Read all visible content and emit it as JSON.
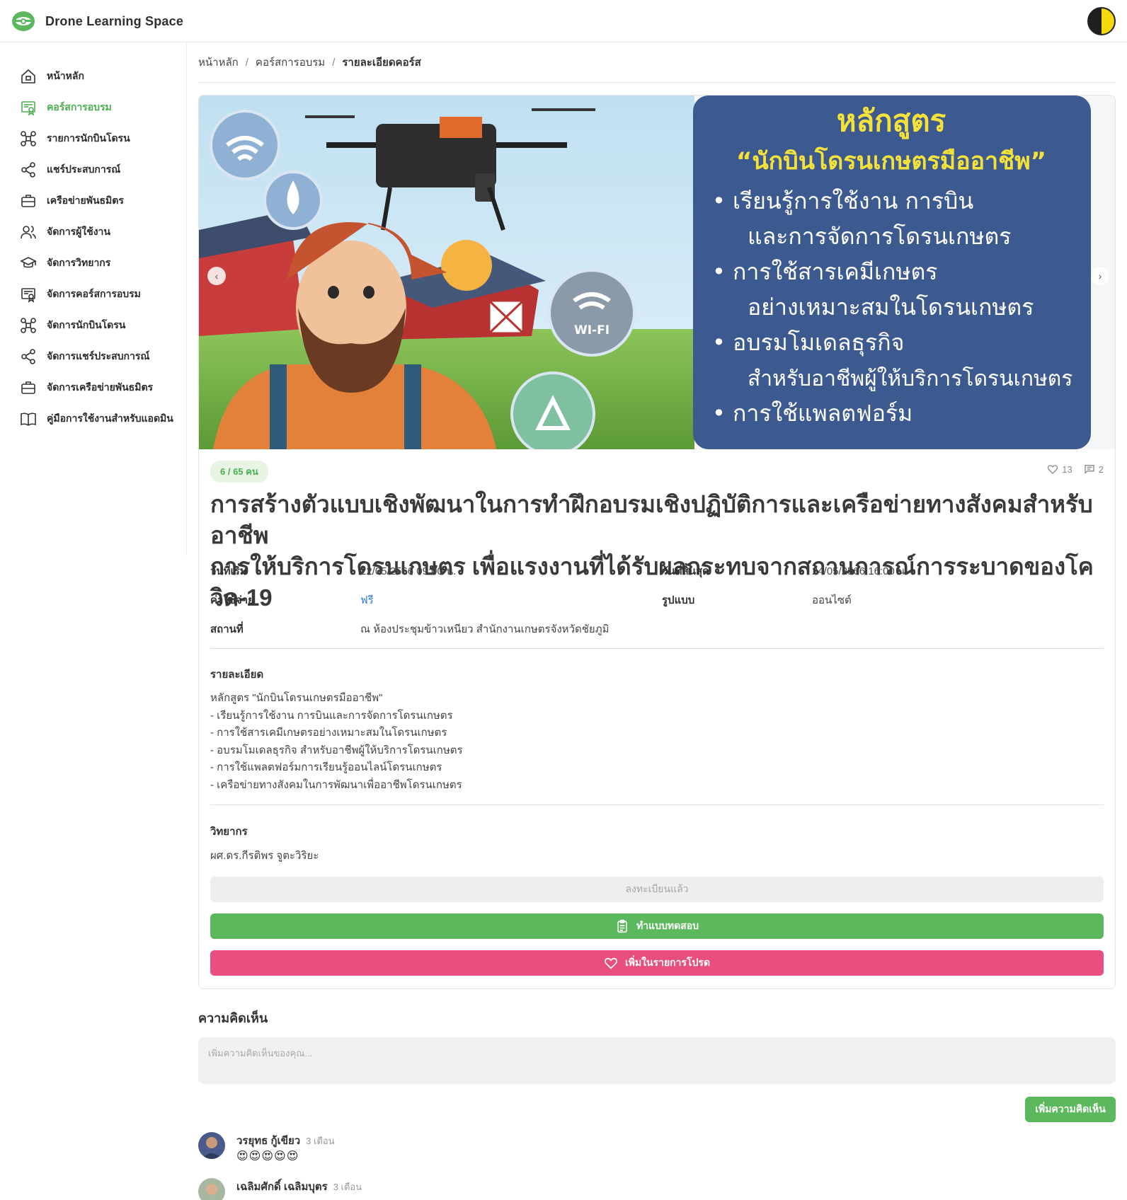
{
  "app": {
    "name": "Drone Learning Space"
  },
  "sidebar": {
    "items": [
      {
        "label": "หน้าหลัก",
        "icon": "home-icon"
      },
      {
        "label": "คอร์สการอบรม",
        "icon": "certificate-icon",
        "active": true
      },
      {
        "label": "รายการนักบินโดรน",
        "icon": "drone-icon"
      },
      {
        "label": "แชร์ประสบการณ์",
        "icon": "share-icon"
      },
      {
        "label": "เครือข่ายพันธมิตร",
        "icon": "briefcase-icon"
      },
      {
        "label": "จัดการผู้ใช้งาน",
        "icon": "users-icon"
      },
      {
        "label": "จัดการวิทยากร",
        "icon": "graduation-cap-icon"
      },
      {
        "label": "จัดการคอร์สการอบรม",
        "icon": "certificate-icon"
      },
      {
        "label": "จัดการนักบินโดรน",
        "icon": "drone-icon"
      },
      {
        "label": "จัดการแชร์ประสบการณ์",
        "icon": "share-icon"
      },
      {
        "label": "จัดการเครือข่ายพันธมิตร",
        "icon": "briefcase-icon"
      },
      {
        "label": "คู่มือการใช้งานสำหรับแอดมิน",
        "icon": "book-icon"
      }
    ]
  },
  "breadcrumb": {
    "home": "หน้าหลัก",
    "courses": "คอร์สการอบรม",
    "current": "รายละเอียดคอร์ส"
  },
  "banner": {
    "heading": "หลักสูตร",
    "subheading": "“นักบินโดรนเกษตรมืออาชีพ”",
    "lines": [
      "• เรียนรู้การใช้งาน การบิน",
      "และการจัดการโดรนเกษตร",
      "• การใช้สารเคมีเกษตร",
      "อย่างเหมาะสมในโดรนเกษตร",
      "• อบรมโมเดลธุรกิจ",
      "สำหรับอาชีพผู้ให้บริการโดรนเกษตร",
      "• การใช้แพลตฟอร์ม"
    ],
    "wifi_text": "WI-FI"
  },
  "course": {
    "seats": "6 / 65 คน",
    "likes": "13",
    "comments_count": "2",
    "title_line1": "การสร้างตัวแบบเชิงพัฒนาในการทำฝึกอบรมเชิงปฏิบัติการและเครือข่ายทางสังคมสำหรับอาชีพ",
    "title_line2": "การให้บริการโดรนเกษตร เพื่อแรงงานที่ได้รับผลกระทบจากสถานการณ์การระบาดของโควิด-19",
    "start_label": "วันที่เริ่ม",
    "start_value": "22/05/2566 09:00 น.",
    "end_label": "วันที่สิ้นสุด",
    "end_value": "24/05/2566 16:00 น.",
    "cost_label": "ค่าใช้จ่าย",
    "cost_value": "ฟรี",
    "format_label": "รูปแบบ",
    "format_value": "ออนไซต์",
    "location_label": "สถานที่",
    "location_value": "ณ ห้องประชุมข้าวเหนียว สำนักงานเกษตรจังหวัดชัยภูมิ",
    "detail_heading": "รายละเอียด",
    "detail_lines": [
      "หลักสูตร \"นักบินโดรนเกษตรมืออาชีพ\"",
      "- เรียนรู้การใช้งาน การบินและการจัดการโดรนเกษตร",
      "- การใช้สารเคมีเกษตรอย่างเหมาะสมในโดรนเกษตร",
      "- อบรมโมเดลธุรกิจ สำหรับอาชีพผู้ให้บริการโดรนเกษตร",
      "- การใช้แพลตฟอร์มการเรียนรู้ออนไลน์โดรนเกษตร",
      "- เครือข่ายทางสังคมในการพัฒนาเพื่ออาชีพโดรนเกษตร"
    ],
    "speaker_heading": "วิทยากร",
    "speaker": "ผศ.ดร.กีรติพร จูตะวิริยะ"
  },
  "buttons": {
    "registered": "ลงทะเบียนแล้ว",
    "quiz": "ทำแบบทดสอบ",
    "favorite": "เพิ่มในรายการโปรด",
    "add_comment": "เพิ่มความคิดเห็น"
  },
  "comments": {
    "heading": "ความคิดเห็น",
    "placeholder": "เพิ่มความคิดเห็นของคุณ...",
    "items": [
      {
        "name": "วรยุทธ กู้เขียว",
        "time": "3 เดือน",
        "text": "😍😍😍😍😍"
      },
      {
        "name": "เฉลิมศักดิ์ เฉลิมบุตร",
        "time": "3 เดือน",
        "text": ""
      }
    ]
  },
  "colors": {
    "accent": "#4caf50",
    "pink": "#e84f7e",
    "banner_blue": "#3c5a8f",
    "banner_yellow": "#f4e23a"
  }
}
